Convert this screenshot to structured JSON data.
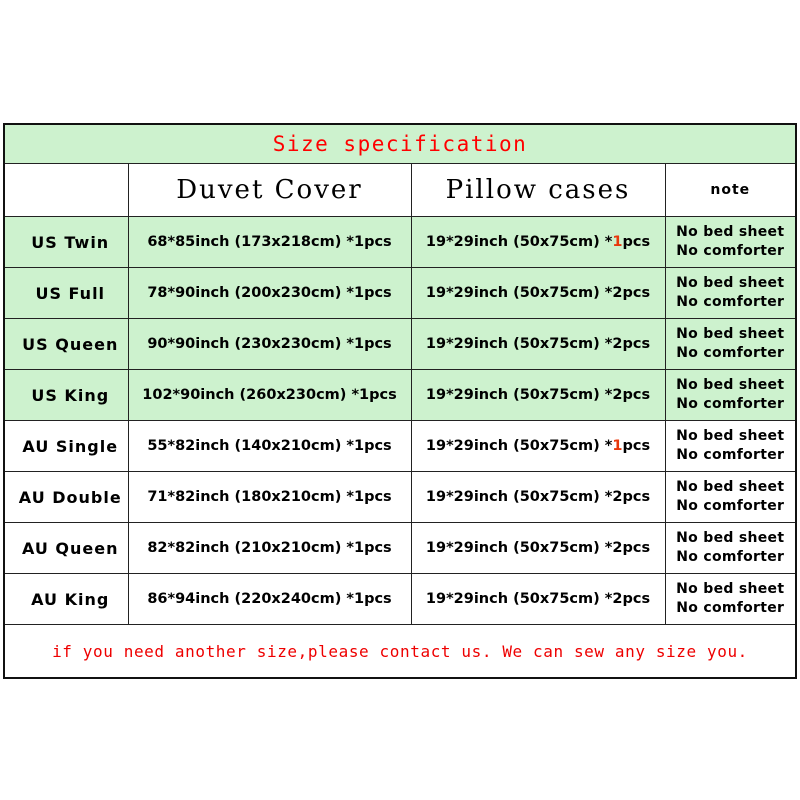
{
  "title": "Size specification",
  "colors": {
    "row_green": "#cdf2ce",
    "row_white": "#ffffff",
    "title_text": "#ff0000",
    "footer_text": "#ee0000",
    "highlight": "#e8380d",
    "border": "#222222"
  },
  "header": {
    "size_label": "",
    "duvet_label": "Duvet Cover",
    "pillow_label": "Pillow cases",
    "note_label": "note"
  },
  "rows": [
    {
      "size": "US Twin",
      "duvet": "68*85inch (173x218cm) *1pcs",
      "pillow_pre": "19*29inch (50x75cm) *",
      "pillow_qty": "1",
      "pillow_post": "pcs",
      "pillow_qty_highlighted": true,
      "note_line1": "No bed sheet",
      "note_line2": "No comforter",
      "shade": "green"
    },
    {
      "size": "US Full",
      "duvet": "78*90inch (200x230cm) *1pcs",
      "pillow_pre": "19*29inch (50x75cm) *",
      "pillow_qty": "2",
      "pillow_post": "pcs",
      "pillow_qty_highlighted": false,
      "note_line1": "No bed sheet",
      "note_line2": "No comforter",
      "shade": "green"
    },
    {
      "size": "US Queen",
      "duvet": "90*90inch (230x230cm) *1pcs",
      "pillow_pre": "19*29inch (50x75cm) *",
      "pillow_qty": "2",
      "pillow_post": "pcs",
      "pillow_qty_highlighted": false,
      "note_line1": "No bed sheet",
      "note_line2": "No comforter",
      "shade": "green"
    },
    {
      "size": "US King",
      "duvet": "102*90inch (260x230cm) *1pcs",
      "pillow_pre": "19*29inch (50x75cm) *",
      "pillow_qty": "2",
      "pillow_post": "pcs",
      "pillow_qty_highlighted": false,
      "note_line1": "No bed sheet",
      "note_line2": "No comforter",
      "shade": "green"
    },
    {
      "size": "AU Single",
      "duvet": "55*82inch (140x210cm) *1pcs",
      "pillow_pre": "19*29inch (50x75cm) *",
      "pillow_qty": "1",
      "pillow_post": "pcs",
      "pillow_qty_highlighted": true,
      "note_line1": "No bed sheet",
      "note_line2": "No comforter",
      "shade": "white"
    },
    {
      "size": "AU Double",
      "duvet": "71*82inch (180x210cm) *1pcs",
      "pillow_pre": "19*29inch (50x75cm) *",
      "pillow_qty": "2",
      "pillow_post": "pcs",
      "pillow_qty_highlighted": false,
      "note_line1": "No bed sheet",
      "note_line2": "No comforter",
      "shade": "white"
    },
    {
      "size": "AU Queen",
      "duvet": "82*82inch (210x210cm) *1pcs",
      "pillow_pre": "19*29inch (50x75cm) *",
      "pillow_qty": "2",
      "pillow_post": "pcs",
      "pillow_qty_highlighted": false,
      "note_line1": "No bed sheet",
      "note_line2": "No comforter",
      "shade": "white"
    },
    {
      "size": "AU King",
      "duvet": "86*94inch (220x240cm) *1pcs",
      "pillow_pre": "19*29inch (50x75cm) *",
      "pillow_qty": "2",
      "pillow_post": "pcs",
      "pillow_qty_highlighted": false,
      "note_line1": "No bed sheet",
      "note_line2": "No comforter",
      "shade": "white"
    }
  ],
  "footer": "if you need another size,please contact us. We can sew any size you."
}
